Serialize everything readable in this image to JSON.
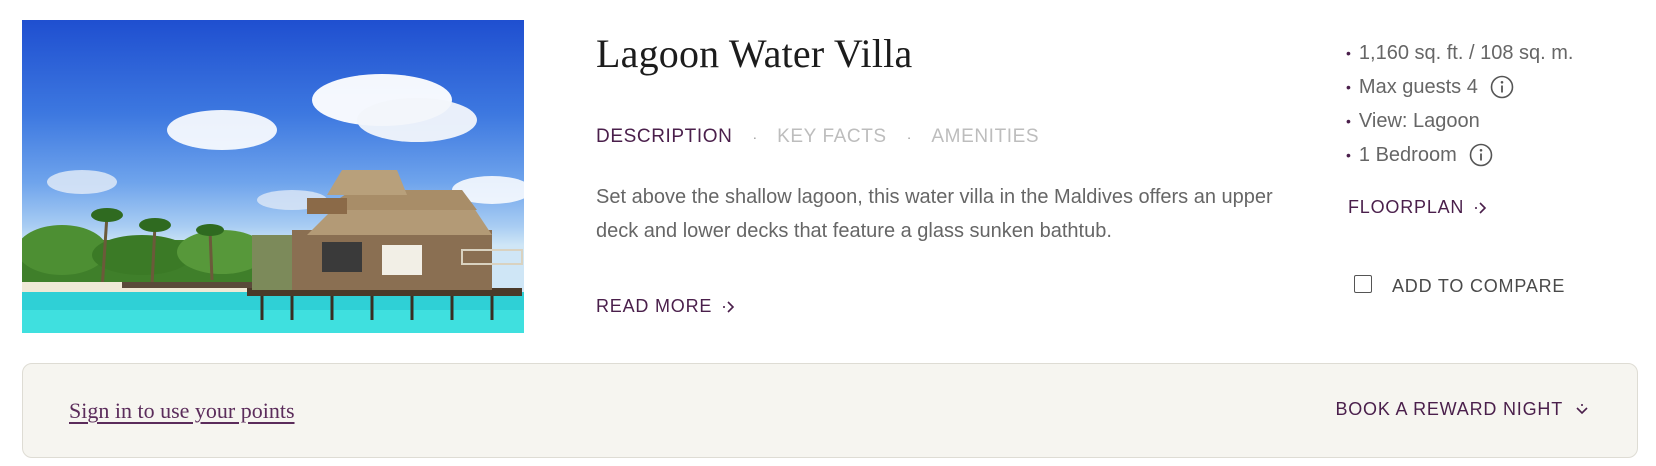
{
  "room": {
    "title": "Lagoon Water Villa",
    "tabs": [
      {
        "label": "DESCRIPTION",
        "active": true
      },
      {
        "label": "KEY FACTS",
        "active": false
      },
      {
        "label": "AMENITIES",
        "active": false
      }
    ],
    "tab_separator": "·",
    "description": "Set above the shallow lagoon, this water villa in the Maldives offers an upper deck and lower decks that feature a glass sunken bathtub.",
    "read_more_label": "READ MORE",
    "image_icon": "overwater-villa-photo"
  },
  "facts": {
    "bullet": "•",
    "items": [
      {
        "text": "1,160 sq. ft. / 108 sq. m.",
        "info_icon": false
      },
      {
        "text": "Max guests 4",
        "info_icon": true
      },
      {
        "text": "View: Lagoon",
        "info_icon": false
      },
      {
        "text": "1 Bedroom",
        "info_icon": true
      }
    ],
    "floorplan_label": "FLOORPLAN",
    "compare_label": "ADD TO COMPARE",
    "compare_checked": false
  },
  "reward_bar": {
    "sign_in_label": "Sign in to use your points",
    "book_label": "BOOK A REWARD NIGHT"
  },
  "colors": {
    "accent": "#4a1f4b",
    "muted_text": "#666666",
    "inactive_tab": "#bdbdbd",
    "reward_bar_bg": "#f6f5f0"
  }
}
